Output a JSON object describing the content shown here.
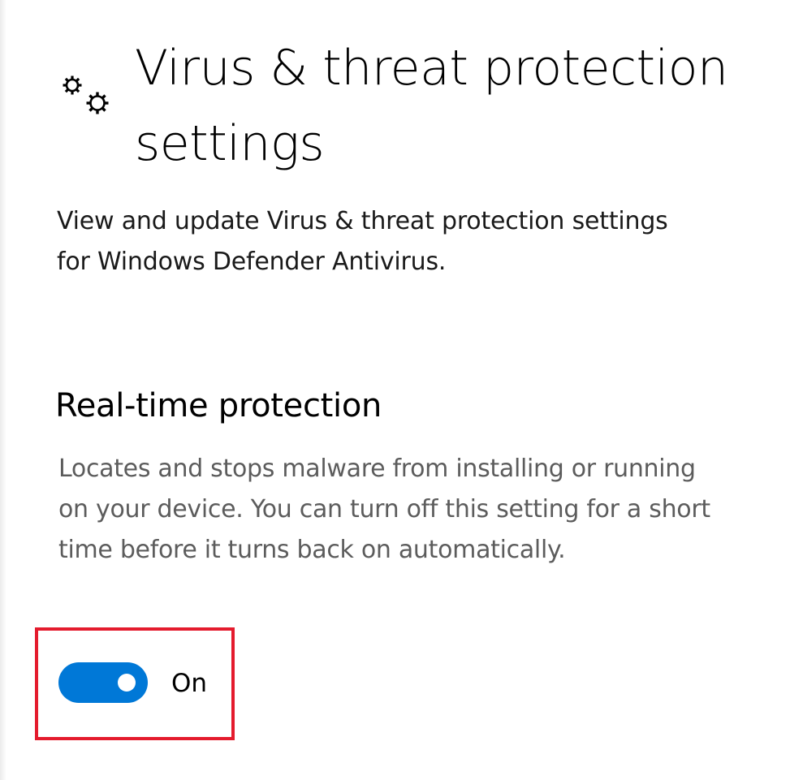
{
  "header": {
    "icon": "gears-icon",
    "title": "Virus & threat protection settings",
    "description": "View and update Virus & threat protection settings for Windows Defender Antivirus."
  },
  "realtime_protection": {
    "title": "Real-time protection",
    "description": "Locates and stops malware from installing or running on your device. You can turn off this setting for a short time before it turns back on automatically.",
    "toggle": {
      "state": true,
      "label": "On"
    }
  },
  "colors": {
    "accent": "#0078d7",
    "highlight_border": "#e41b2d",
    "secondary_text": "#5c5c5c"
  }
}
